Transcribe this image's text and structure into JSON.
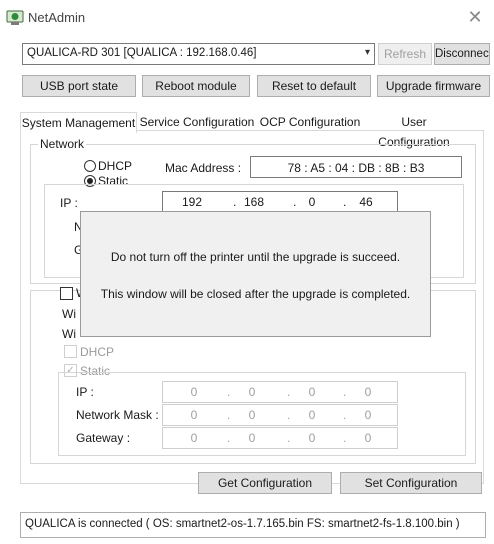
{
  "window": {
    "title": "NetAdmin"
  },
  "connection": {
    "device_selected": "QUALICA-RD 301 [QUALICA : 192.168.0.46]",
    "refresh_label": "Refresh",
    "disconnect_label": "Disconnect"
  },
  "actions": {
    "usb_port_state": "USB port state",
    "reboot_module": "Reboot module",
    "reset_to_default": "Reset to default",
    "upgrade_firmware": "Upgrade firmware"
  },
  "tabs": [
    {
      "label": "System Management",
      "active": true
    },
    {
      "label": "Service Configuration",
      "active": false
    },
    {
      "label": "OCP Configuration",
      "active": false
    },
    {
      "label": "User Configuration",
      "active": false
    }
  ],
  "network": {
    "group_label": "Network",
    "dhcp_label": "DHCP",
    "static_label": "Static",
    "mac_label": "Mac Address :",
    "mac_value": "78 : A5 : 04 : DB : 8B : B3",
    "ip_label": "IP :",
    "ip": [
      "192",
      "168",
      "0",
      "46"
    ],
    "dot": "."
  },
  "wifi": {
    "dhcp_label": "DHCP",
    "static_label": "Static",
    "ip_label": "IP :",
    "mask_label": "Network Mask :",
    "gateway_label": "Gateway :",
    "ip": [
      "0",
      "0",
      "0",
      "0"
    ],
    "mask": [
      "0",
      "0",
      "0",
      "0"
    ],
    "gateway": [
      "0",
      "0",
      "0",
      "0"
    ]
  },
  "overlay": {
    "line1": "Do not turn off the printer until the upgrade is succeed.",
    "line2": "This window will be closed after the upgrade is completed."
  },
  "buttons": {
    "get_config": "Get Configuration",
    "set_config": "Set Configuration"
  },
  "status": {
    "text": "QUALICA is connected ( OS: smartnet2-os-1.7.165.bin  FS: smartnet2-fs-1.8.100.bin )"
  },
  "colors": {
    "icon_green": "#2e8b3a",
    "disabled_gray": "#a0a0a0"
  }
}
